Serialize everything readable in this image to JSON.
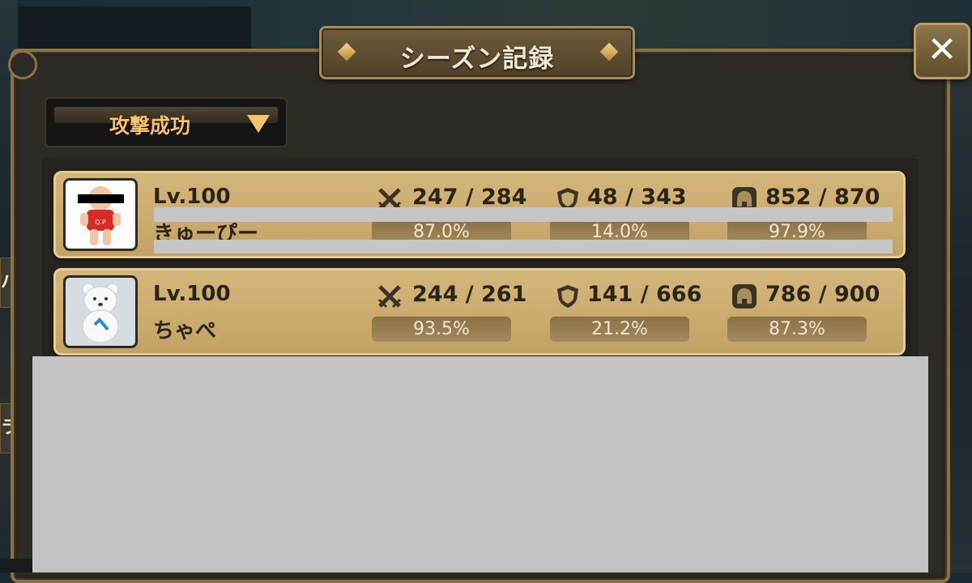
{
  "window": {
    "title": "シーズン記録",
    "close_label": "✕"
  },
  "filter": {
    "selected": "攻撃成功"
  },
  "records": [
    {
      "level": "Lv.100",
      "name": "きゅーぴー",
      "attack": {
        "value": "247 / 284",
        "percent": "87.0%"
      },
      "defense": {
        "value": "48 / 343",
        "percent": "14.0%"
      },
      "siege": {
        "value": "852 / 870",
        "percent": "97.9%"
      },
      "avatar": "kewpie-doll-icon"
    },
    {
      "level": "Lv.100",
      "name": "ちゃぺ",
      "attack": {
        "value": "244 / 261",
        "percent": "93.5%"
      },
      "defense": {
        "value": "141 / 666",
        "percent": "21.2%"
      },
      "siege": {
        "value": "786 / 900",
        "percent": "87.3%"
      },
      "avatar": "white-bear-icon"
    }
  ],
  "icons": {
    "attack": "crossed-swords-icon",
    "defense": "shield-icon",
    "siege": "helmet-icon"
  },
  "colors": {
    "panel_border": "#8a7246",
    "row_bg": "#c4a265",
    "gold_text": "#f4c36a",
    "redaction": "#c3c3c3"
  },
  "side_tabs": [
    "バ",
    "ラ"
  ]
}
